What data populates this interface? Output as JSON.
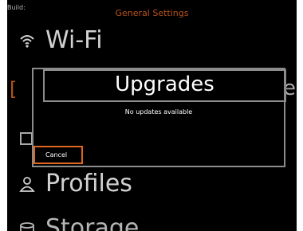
{
  "header": {
    "build_label": "Build:",
    "title": "General Settings"
  },
  "menu": {
    "items": [
      {
        "label": "Wi-Fi",
        "icon": "wifi-icon"
      },
      {
        "label": "Profiles",
        "icon": "user-icon"
      },
      {
        "label": "Storage",
        "icon": "storage-icon"
      }
    ]
  },
  "dialog": {
    "title": "Upgrades",
    "message": "No updates available",
    "cancel_label": "Cancel"
  },
  "colors": {
    "accent": "#e0651f",
    "background": "#000000",
    "text": "#ffffff",
    "dialog_border": "#8c8c8c"
  }
}
